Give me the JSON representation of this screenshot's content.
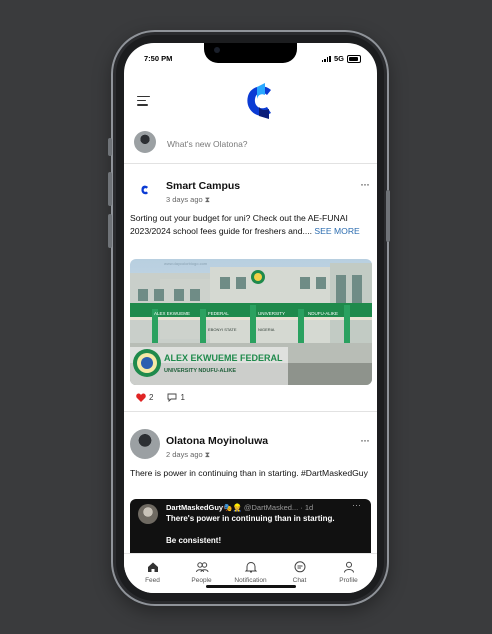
{
  "status_bar": {
    "time": "7:50 PM",
    "network": "5G"
  },
  "composer": {
    "prompt": "What's new Olatona?"
  },
  "posts": [
    {
      "author": "Smart Campus",
      "time_ago": "3 days ago",
      "text": "Sorting out your budget for uni? Check out the AE-FUNAI 2023/2024 school fees guide for freshers and....",
      "see_more": "SEE MORE",
      "image": {
        "watermark": "www.daycolorbiogo.com",
        "sign_left": "ALEX EKWUEME",
        "sign_mid": "FEDERAL",
        "sign_right": "UNIVERSITY",
        "sign_far": "NDUFU-ALIKE",
        "sign_row2_left": "EBONYI STATE",
        "sign_row2_right": "NIGERIA",
        "banner_title": "ALEX EKWUEME FEDERAL",
        "banner_sub": "UNIVERSITY NDUFU-ALIKE"
      },
      "likes": "2",
      "comments": "1"
    },
    {
      "author": "Olatona Moyinoluwa",
      "time_ago": "2 days ago",
      "text": "There is power in continuing than in starting. #DartMaskedGuy",
      "quoted": {
        "name": "DartMaskedGuy🎭👷",
        "handle": "@DartMasked... · 1d",
        "line1": "There's power in continuing than in starting.",
        "line2": "Be consistent!"
      }
    }
  ],
  "tabs": [
    {
      "label": "Feed",
      "icon": "home-icon"
    },
    {
      "label": "People",
      "icon": "people-icon"
    },
    {
      "label": "Notification",
      "icon": "bell-icon"
    },
    {
      "label": "Chat",
      "icon": "chat-icon"
    },
    {
      "label": "Profile",
      "icon": "user-icon"
    }
  ],
  "colors": {
    "accent": "#1a63ff",
    "link": "#2b6cb0",
    "like": "#e02424",
    "backdrop": "#3a3b3d"
  }
}
